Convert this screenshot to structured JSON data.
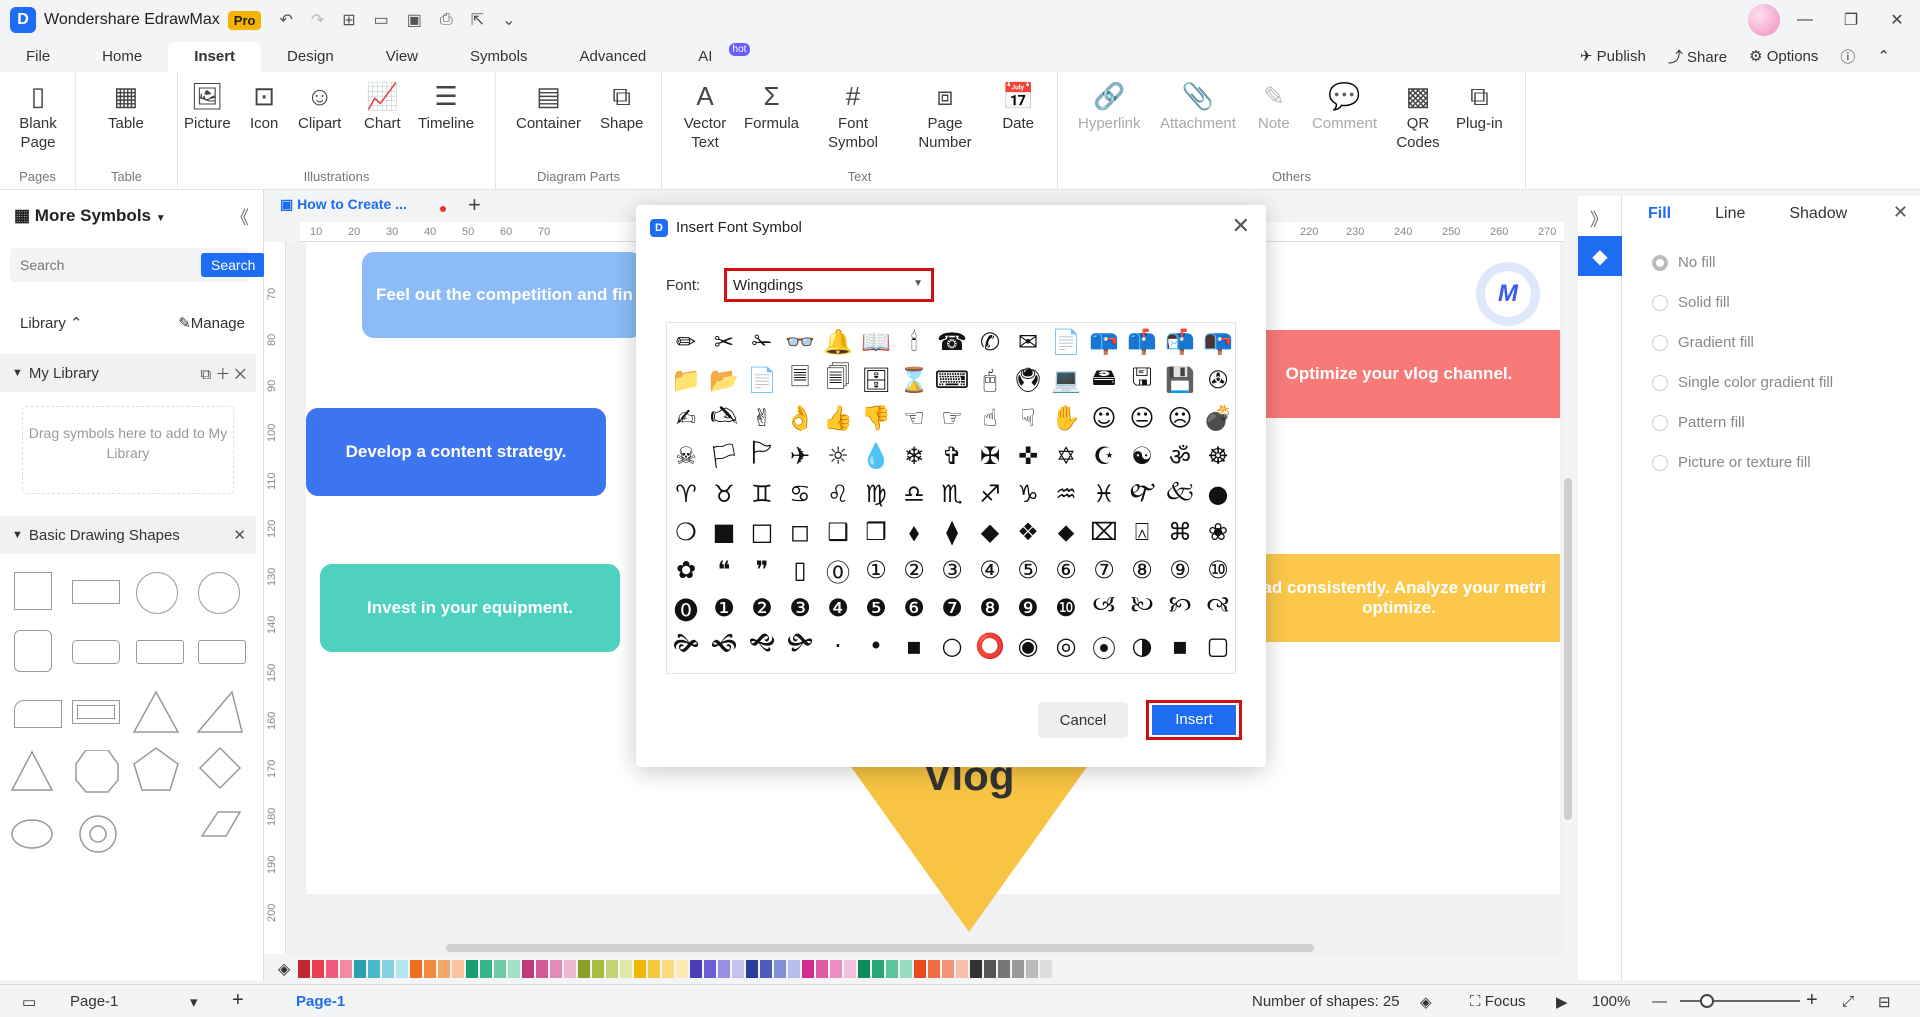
{
  "app": {
    "title": "Wondershare EdrawMax",
    "badge": "Pro"
  },
  "menu": {
    "tabs": [
      "File",
      "Home",
      "Insert",
      "Design",
      "View",
      "Symbols",
      "Advanced",
      "AI"
    ],
    "active": "Insert",
    "hot_badge": "hot",
    "publish": "Publish",
    "share": "Share",
    "options": "Options"
  },
  "ribbon": {
    "groups": [
      {
        "label": "Pages",
        "buttons": [
          "Blank Page"
        ]
      },
      {
        "label": "Table",
        "buttons": [
          "Table"
        ]
      },
      {
        "label": "Illustrations",
        "buttons": [
          "Picture",
          "Icon",
          "Clipart",
          "Chart",
          "Timeline"
        ]
      },
      {
        "label": "Diagram Parts",
        "buttons": [
          "Container",
          "Shape"
        ]
      },
      {
        "label": "Text",
        "buttons": [
          "Vector Text",
          "Formula",
          "Font Symbol",
          "Page Number",
          "Date"
        ]
      },
      {
        "label": "Others",
        "buttons": [
          "Hyperlink",
          "Attachment",
          "Note",
          "Comment",
          "QR Codes",
          "Plug-in"
        ]
      }
    ]
  },
  "left_panel": {
    "title": "More Symbols",
    "search_placeholder": "Search",
    "search_button": "Search",
    "library_label": "Library",
    "manage_label": "Manage",
    "my_library": "My Library",
    "drop_hint": "Drag symbols here to add to My Library",
    "basic_shapes": "Basic Drawing Shapes"
  },
  "doc_tab": {
    "title": "How to Create ..."
  },
  "ruler": {
    "top": [
      "10",
      "20",
      "30",
      "40",
      "50",
      "60",
      "70",
      "220",
      "230",
      "240",
      "250",
      "260",
      "270"
    ],
    "left": [
      "70",
      "80",
      "90",
      "100",
      "110",
      "120",
      "130",
      "140",
      "150",
      "160",
      "170",
      "180",
      "190",
      "200"
    ]
  },
  "canvas": {
    "cards": [
      {
        "text": "Feel out the competition and fin",
        "color": "#8bbcf7"
      },
      {
        "text": "Develop a content strategy.",
        "color": "#3d74f0"
      },
      {
        "text": "Invest in your equipment.",
        "color": "#4fd1c0"
      },
      {
        "text": "Optimize your vlog channel.",
        "color": "#f77a78"
      },
      {
        "text": "oad consistently. Analyze your metri optimize.",
        "color": "#fbc84b"
      }
    ],
    "center_label": "Vlog"
  },
  "right_panel": {
    "tabs": [
      "Fill",
      "Line",
      "Shadow"
    ],
    "active": "Fill",
    "fill_options": [
      "No fill",
      "Solid fill",
      "Gradient fill",
      "Single color gradient fill",
      "Pattern fill",
      "Picture or texture fill"
    ],
    "selected_option": "No fill"
  },
  "status": {
    "page_select": "Page-1",
    "page_tab": "Page-1",
    "shape_count": "Number of shapes: 25",
    "focus": "Focus",
    "zoom": "100%"
  },
  "dialog": {
    "title": "Insert Font Symbol",
    "font_label": "Font:",
    "font_value": "Wingdings",
    "cancel": "Cancel",
    "insert": "Insert",
    "symbols": [
      "✏",
      "✂",
      "✁",
      "👓",
      "🔔",
      "📖",
      "🕯",
      "☎",
      "✆",
      "✉",
      "📄",
      "📪",
      "📫",
      "📬",
      "📭",
      "📁",
      "📂",
      "📄",
      "🗏",
      "🗐",
      "🗄",
      "⌛",
      "⌨",
      "🖰",
      "🖲",
      "💻",
      "🖴",
      "🖫",
      "💾",
      "✇",
      "✍",
      "🖎",
      "✌",
      "👌",
      "👍",
      "👎",
      "☜",
      "☞",
      "☝",
      "☟",
      "✋",
      "☺",
      "😐",
      "☹",
      "💣",
      "☠",
      "🏳",
      "🏱",
      "✈",
      "☼",
      "💧",
      "❄",
      "✞",
      "✠",
      "✜",
      "✡",
      "☪",
      "☯",
      "ॐ",
      "☸",
      "♈",
      "♉",
      "♊",
      "♋",
      "♌",
      "♍",
      "♎",
      "♏",
      "♐",
      "♑",
      "♒",
      "♓",
      "🙰",
      "🙵",
      "●",
      "❍",
      "■",
      "□",
      "◻",
      "❑",
      "❒",
      "⬧",
      "⧫",
      "◆",
      "❖",
      "⬥",
      "⌧",
      "⍓",
      "⌘",
      "❀",
      "✿",
      "❝",
      "❞",
      "▯",
      "⓪",
      "①",
      "②",
      "③",
      "④",
      "⑤",
      "⑥",
      "⑦",
      "⑧",
      "⑨",
      "⑩",
      "⓿",
      "❶",
      "❷",
      "❸",
      "❹",
      "❺",
      "❻",
      "❼",
      "❽",
      "❾",
      "❿",
      "🙢",
      "🙠",
      "🙡",
      "🙣",
      "🙞",
      "🙜",
      "🙝",
      "🙟",
      "·",
      "•",
      "▪",
      "○",
      "⭕",
      "◉",
      "◎",
      "⦿",
      "◑",
      "▪",
      "▢"
    ]
  },
  "palette": [
    "#c1272d",
    "#e8414d",
    "#f05a78",
    "#f48aa0",
    "#2e9fb3",
    "#4ab8c8",
    "#82d3df",
    "#b5e6ee",
    "#ef6c20",
    "#f3893f",
    "#f7a66a",
    "#f9c39b",
    "#1d9e6f",
    "#3ab58a",
    "#6dcca8",
    "#a3e0c7",
    "#b83c7e",
    "#d35a98",
    "#e38ab5",
    "#efb8d2",
    "#8aa02a",
    "#a8bc3f",
    "#c5d473",
    "#dfe8a9",
    "#f2b705",
    "#f6c93a",
    "#f9db7a",
    "#fcebb5",
    "#4a3db8",
    "#6b5fd3",
    "#9990e4",
    "#c6c1f0",
    "#2b3b9c",
    "#4c5dbd",
    "#808fd8",
    "#b4bfeb",
    "#d22e8f",
    "#e05aa8",
    "#eb8dc3",
    "#f4bfdc",
    "#0e8c5a",
    "#29a775",
    "#5cc59b",
    "#97dcbf",
    "#e94b1b",
    "#f06d41",
    "#f59576",
    "#f9bea9",
    "#333333",
    "#555555",
    "#777777",
    "#999999",
    "#bbbbbb",
    "#dddddd"
  ]
}
